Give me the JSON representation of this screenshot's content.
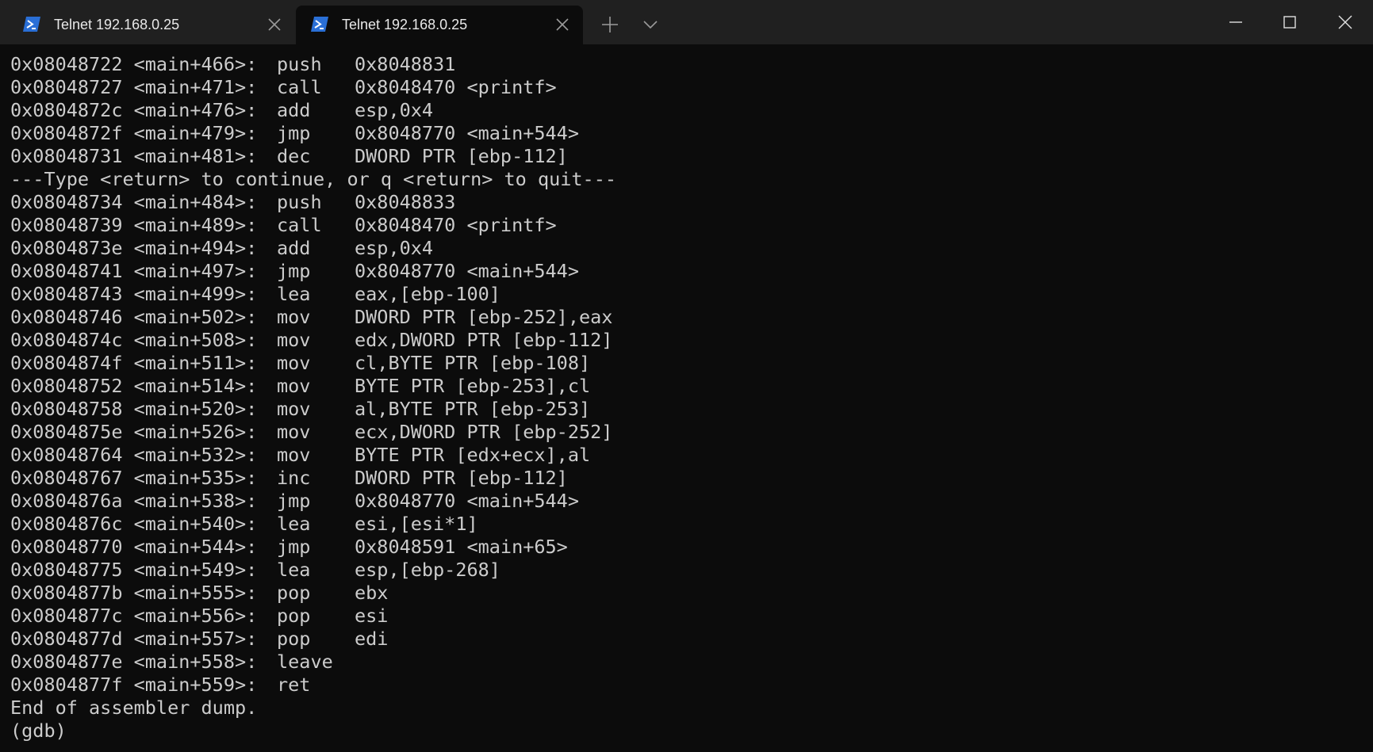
{
  "tabs": [
    {
      "title": "Telnet 192.168.0.25",
      "active": false
    },
    {
      "title": "Telnet 192.168.0.25",
      "active": true
    }
  ],
  "colors": {
    "titlebar": "#202020",
    "terminal_bg": "#0c0c0c",
    "terminal_fg": "#cccccc",
    "ps_icon": "#2a6fd6"
  },
  "icons": {
    "tab_icon": "powershell-icon",
    "new_tab": "plus-icon",
    "dropdown": "chevron-down-icon",
    "minimize": "minimize-icon",
    "maximize": "maximize-icon",
    "close": "close-icon"
  },
  "terminal": {
    "lines": [
      {
        "addr": "0x08048722 <main+466>:",
        "mnem": "push",
        "ops": "0x8048831"
      },
      {
        "addr": "0x08048727 <main+471>:",
        "mnem": "call",
        "ops": "0x8048470 <printf>"
      },
      {
        "addr": "0x0804872c <main+476>:",
        "mnem": "add",
        "ops": "esp,0x4"
      },
      {
        "addr": "0x0804872f <main+479>:",
        "mnem": "jmp",
        "ops": "0x8048770 <main+544>"
      },
      {
        "addr": "0x08048731 <main+481>:",
        "mnem": "dec",
        "ops": "DWORD PTR [ebp-112]"
      },
      {
        "text": "---Type <return> to continue, or q <return> to quit---"
      },
      {
        "addr": "0x08048734 <main+484>:",
        "mnem": "push",
        "ops": "0x8048833"
      },
      {
        "addr": "0x08048739 <main+489>:",
        "mnem": "call",
        "ops": "0x8048470 <printf>"
      },
      {
        "addr": "0x0804873e <main+494>:",
        "mnem": "add",
        "ops": "esp,0x4"
      },
      {
        "addr": "0x08048741 <main+497>:",
        "mnem": "jmp",
        "ops": "0x8048770 <main+544>"
      },
      {
        "addr": "0x08048743 <main+499>:",
        "mnem": "lea",
        "ops": "eax,[ebp-100]"
      },
      {
        "addr": "0x08048746 <main+502>:",
        "mnem": "mov",
        "ops": "DWORD PTR [ebp-252],eax"
      },
      {
        "addr": "0x0804874c <main+508>:",
        "mnem": "mov",
        "ops": "edx,DWORD PTR [ebp-112]"
      },
      {
        "addr": "0x0804874f <main+511>:",
        "mnem": "mov",
        "ops": "cl,BYTE PTR [ebp-108]"
      },
      {
        "addr": "0x08048752 <main+514>:",
        "mnem": "mov",
        "ops": "BYTE PTR [ebp-253],cl"
      },
      {
        "addr": "0x08048758 <main+520>:",
        "mnem": "mov",
        "ops": "al,BYTE PTR [ebp-253]"
      },
      {
        "addr": "0x0804875e <main+526>:",
        "mnem": "mov",
        "ops": "ecx,DWORD PTR [ebp-252]"
      },
      {
        "addr": "0x08048764 <main+532>:",
        "mnem": "mov",
        "ops": "BYTE PTR [edx+ecx],al"
      },
      {
        "addr": "0x08048767 <main+535>:",
        "mnem": "inc",
        "ops": "DWORD PTR [ebp-112]"
      },
      {
        "addr": "0x0804876a <main+538>:",
        "mnem": "jmp",
        "ops": "0x8048770 <main+544>"
      },
      {
        "addr": "0x0804876c <main+540>:",
        "mnem": "lea",
        "ops": "esi,[esi*1]"
      },
      {
        "addr": "0x08048770 <main+544>:",
        "mnem": "jmp",
        "ops": "0x8048591 <main+65>"
      },
      {
        "addr": "0x08048775 <main+549>:",
        "mnem": "lea",
        "ops": "esp,[ebp-268]"
      },
      {
        "addr": "0x0804877b <main+555>:",
        "mnem": "pop",
        "ops": "ebx"
      },
      {
        "addr": "0x0804877c <main+556>:",
        "mnem": "pop",
        "ops": "esi"
      },
      {
        "addr": "0x0804877d <main+557>:",
        "mnem": "pop",
        "ops": "edi"
      },
      {
        "addr": "0x0804877e <main+558>:",
        "mnem": "leave",
        "ops": ""
      },
      {
        "addr": "0x0804877f <main+559>:",
        "mnem": "ret",
        "ops": ""
      },
      {
        "text": "End of assembler dump."
      },
      {
        "text": "(gdb)"
      }
    ]
  }
}
